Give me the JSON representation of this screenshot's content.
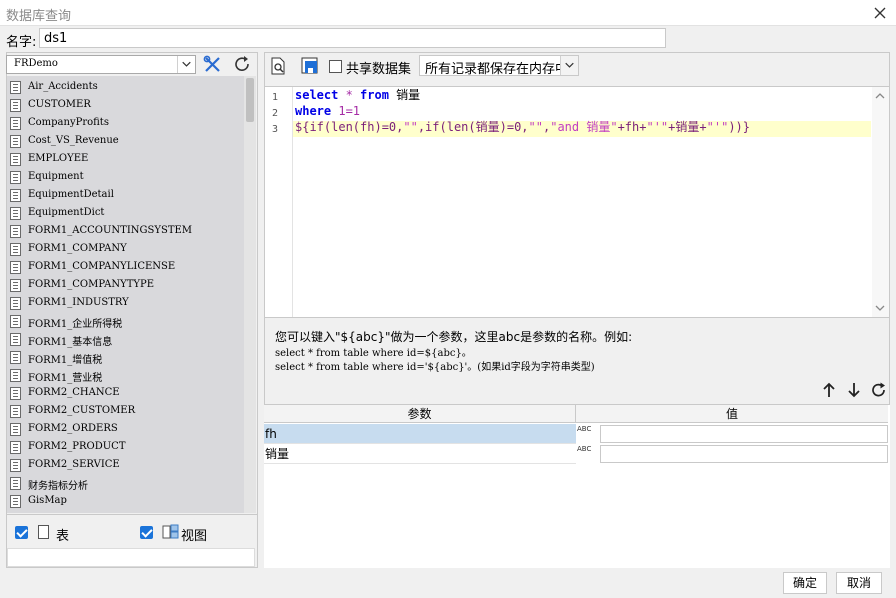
{
  "window": {
    "title": "数据库查询"
  },
  "name_field": {
    "label": "名字:",
    "value": "ds1"
  },
  "connection": {
    "selected": "FRDemo"
  },
  "tables": [
    "Air_Accidents",
    "CUSTOMER",
    "CompanyProfits",
    "Cost_VS_Revenue",
    "EMPLOYEE",
    "Equipment",
    "EquipmentDetail",
    "EquipmentDict",
    "FORM1_ACCOUNTINGSYSTEM",
    "FORM1_COMPANY",
    "FORM1_COMPANYLICENSE",
    "FORM1_COMPANYTYPE",
    "FORM1_INDUSTRY",
    "FORM1_企业所得税",
    "FORM1_基本信息",
    "FORM1_增值税",
    "FORM1_营业税",
    "FORM2_CHANCE",
    "FORM2_CUSTOMER",
    "FORM2_ORDERS",
    "FORM2_PRODUCT",
    "FORM2_SERVICE",
    "财务指标分析",
    "GisMap"
  ],
  "filters": {
    "table_label": "表",
    "view_label": "视图"
  },
  "toolbar": {
    "share_label": "共享数据集",
    "memory_option": "所有记录都保存在内存中"
  },
  "editor": {
    "line_numbers": [
      "1",
      "2",
      "3"
    ],
    "line1": {
      "kw1": "select",
      "op": " * ",
      "kw2": "from",
      "rest": " 销量"
    },
    "line2": {
      "kw": "where",
      "rest": " 1=1"
    },
    "line3": {
      "a": "${if(len(fh)=0,",
      "b": "\"\"",
      "c": ",if(len(销量)=0,",
      "d": "\"\"",
      "e": ",",
      "f": "\"and 销量\"",
      "g": "+fh+",
      "h": "\"'\"",
      "i": "+销量+",
      "j": "\"'\"",
      "k": "))}"
    }
  },
  "hint": {
    "line1": "您可以键入\"${abc}\"做为一个参数，这里abc是参数的名称。例如:",
    "line2": "select * from table where id=${abc}。",
    "line3": "select * from table where id='${abc}'。(如果id字段为字符串类型)"
  },
  "params": {
    "header_param": "参数",
    "header_value": "值",
    "type_icon_text": "ABC",
    "rows": [
      {
        "name": "fh",
        "value": ""
      },
      {
        "name": "销量",
        "value": ""
      }
    ]
  },
  "buttons": {
    "ok": "确定",
    "cancel": "取消"
  },
  "colors": {
    "selected_row": "#c7dcef",
    "list_bg": "#d9d9dc",
    "highlight_line": "#ffffcc",
    "keyword": "#0000e6",
    "string": "#c23fc2"
  }
}
